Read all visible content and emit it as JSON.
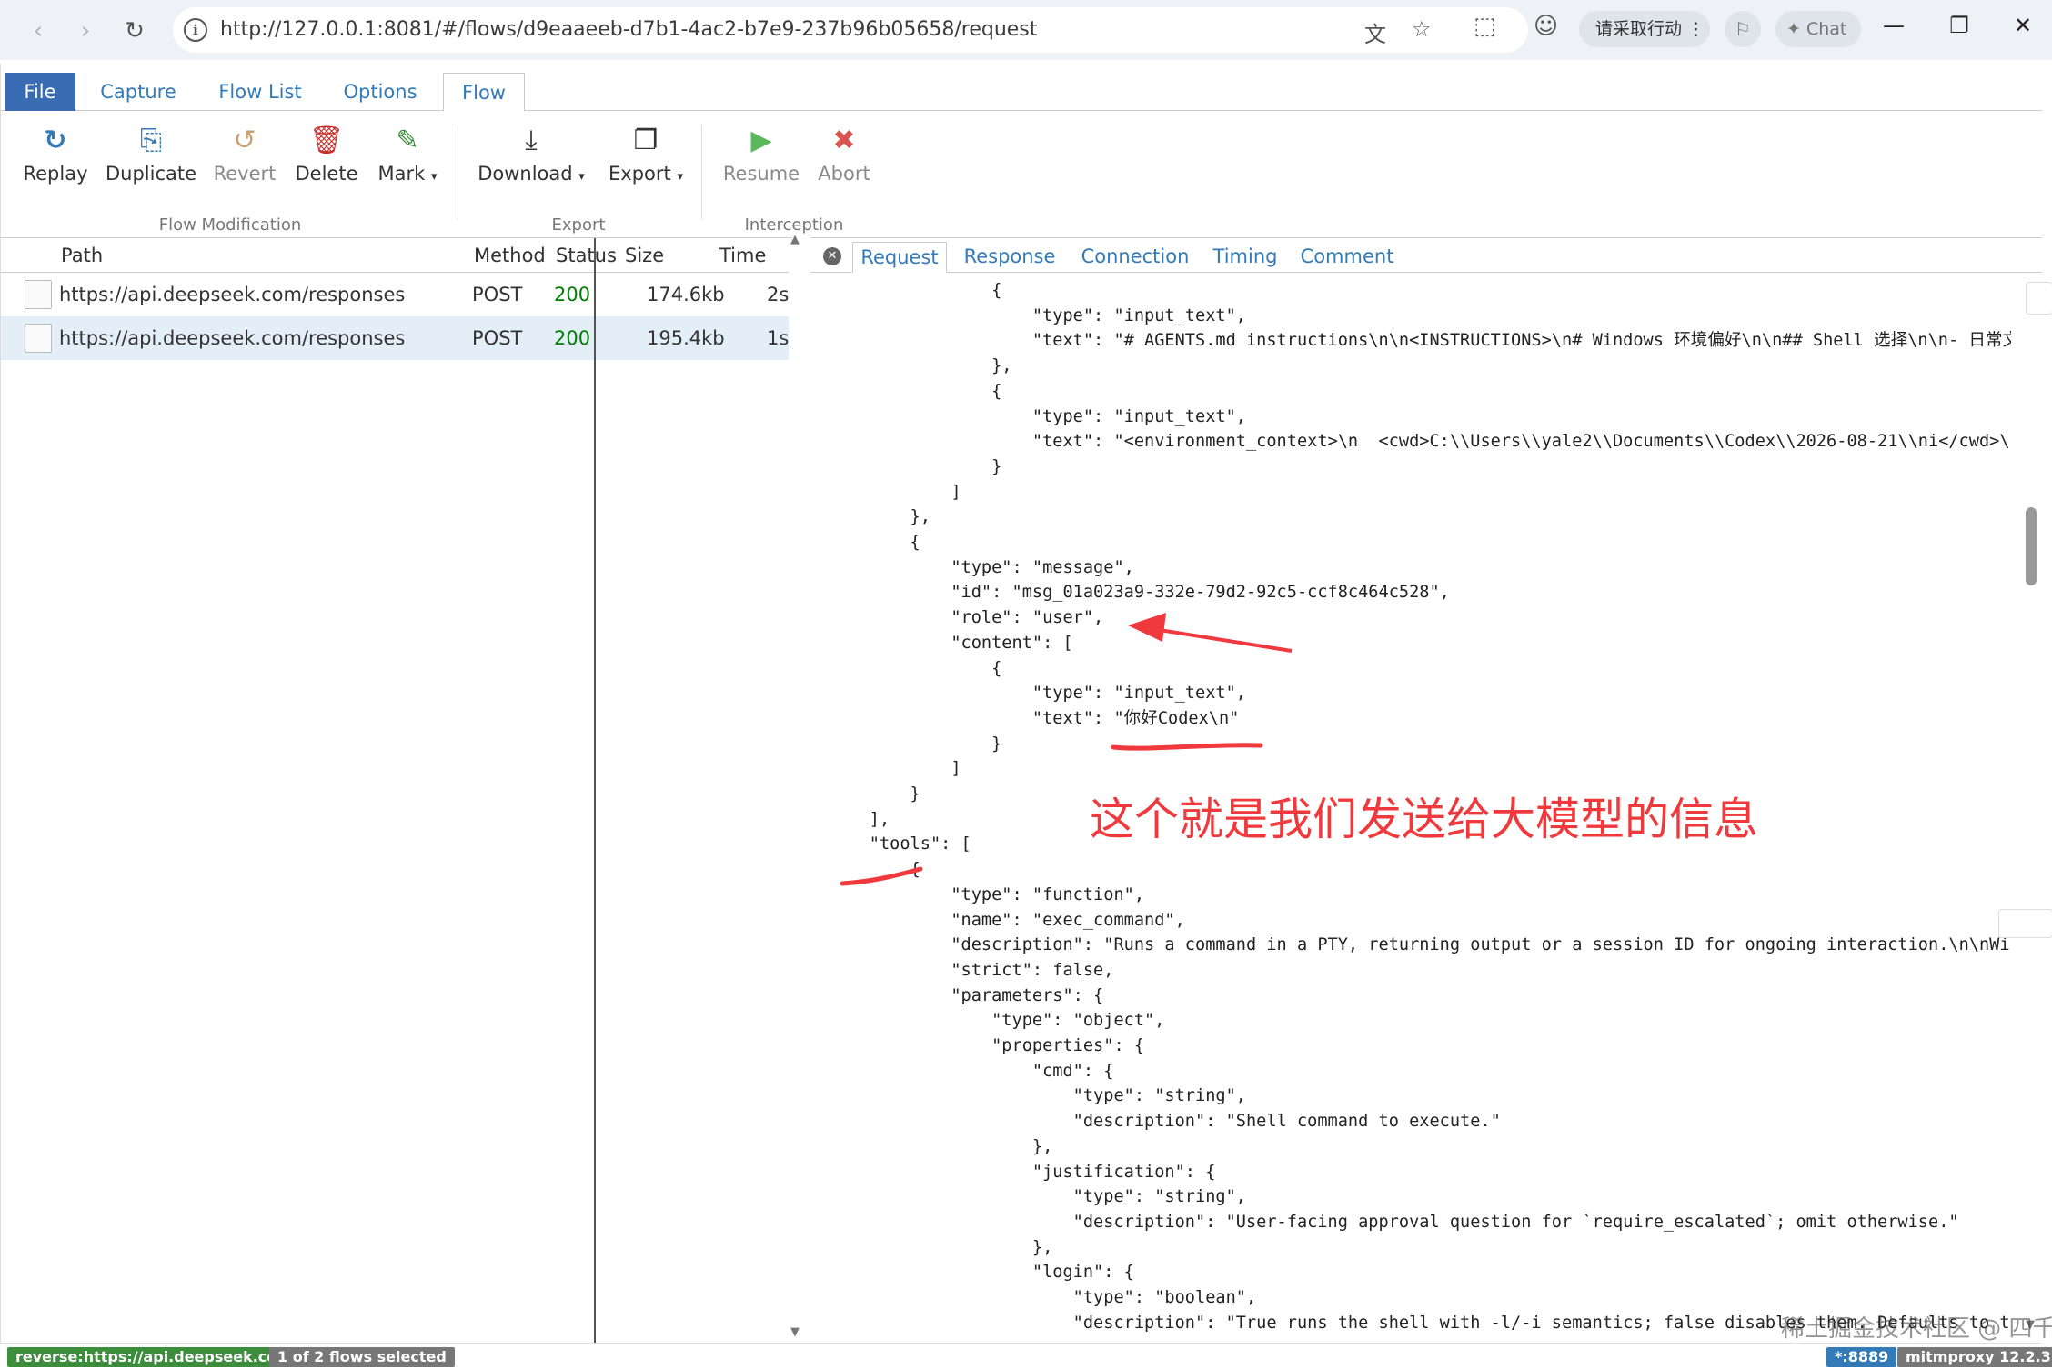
{
  "browser": {
    "url": "http://127.0.0.1:8081/#/flows/d9eaaeeb-d7b1-4ac2-b7e9-237b96b05658/request",
    "translate_pill": "请采取行动",
    "chat_label": "Chat"
  },
  "menu": {
    "tabs": [
      "File",
      "Capture",
      "Flow List",
      "Options",
      "Flow"
    ],
    "active": "Flow"
  },
  "toolbar": {
    "replay": "Replay",
    "duplicate": "Duplicate",
    "revert": "Revert",
    "delete": "Delete",
    "mark": "Mark",
    "download": "Download",
    "export": "Export",
    "resume": "Resume",
    "abort": "Abort",
    "groups": {
      "flow_modification": "Flow Modification",
      "export": "Export",
      "interception": "Interception"
    }
  },
  "flow_table": {
    "columns": {
      "path": "Path",
      "method": "Method",
      "status": "Status",
      "size": "Size",
      "time": "Time"
    },
    "rows": [
      {
        "path": "https://api.deepseek.com/responses",
        "method": "POST",
        "status": "200",
        "size": "174.6kb",
        "time": "2s",
        "selected": false
      },
      {
        "path": "https://api.deepseek.com/responses",
        "method": "POST",
        "status": "200",
        "size": "195.4kb",
        "time": "1s",
        "selected": true
      }
    ]
  },
  "detail": {
    "tabs": [
      "Request",
      "Response",
      "Connection",
      "Timing",
      "Comment"
    ],
    "active_tab": "Request",
    "code_lines": [
      "                {",
      "                    \"type\": \"input_text\",",
      "                    \"text\": \"# AGENTS.md instructions\\n\\n<INSTRUCTIONS>\\n# Windows 环境偏好\\n\\n## Shell 选择\\n\\n- 日常文件",
      "                },",
      "                {",
      "                    \"type\": \"input_text\",",
      "                    \"text\": \"<environment_context>\\n  <cwd>C:\\\\Users\\\\yale2\\\\Documents\\\\Codex\\\\2026-08-21\\\\ni</cwd>\\n  <",
      "                }",
      "            ]",
      "        },",
      "        {",
      "            \"type\": \"message\",",
      "            \"id\": \"msg_01a023a9-332e-79d2-92c5-ccf8c464c528\",",
      "            \"role\": \"user\",",
      "            \"content\": [",
      "                {",
      "                    \"type\": \"input_text\",",
      "                    \"text\": \"你好Codex\\n\"",
      "                }",
      "            ]",
      "        }",
      "    ],",
      "    \"tools\": [",
      "        {",
      "            \"type\": \"function\",",
      "            \"name\": \"exec_command\",",
      "            \"description\": \"Runs a command in a PTY, returning output or a session ID for ongoing interaction.\\n\\nWindow",
      "            \"strict\": false,",
      "            \"parameters\": {",
      "                \"type\": \"object\",",
      "                \"properties\": {",
      "                    \"cmd\": {",
      "                        \"type\": \"string\",",
      "                        \"description\": \"Shell command to execute.\"",
      "                    },",
      "                    \"justification\": {",
      "                        \"type\": \"string\",",
      "                        \"description\": \"User-facing approval question for `require_escalated`; omit otherwise.\"",
      "                    },",
      "                    \"login\": {",
      "                        \"type\": \"boolean\",",
      "                        \"description\": \"True runs the shell with -l/-i semantics; false disables them. Defaults to true.\""
    ]
  },
  "annotation": {
    "text": "这个就是我们发送给大模型的信息",
    "color": "#f0393c"
  },
  "statusbar": {
    "mode": "reverse:https://api.deepseek.com",
    "selection": "1 of 2 flows selected",
    "port": "*:8889",
    "version": "mitmproxy 12.2.3"
  },
  "watermark": "稀土掘金技术社区 @ 四千岁",
  "colors": {
    "brand_blue": "#396cb2",
    "link_blue": "#337ab7",
    "status_green": "#008000",
    "replay_blue": "#337ab7",
    "delete_red": "#c9302c",
    "mark_green": "#3c8d3c",
    "resume_green": "#5cb85c",
    "abort_red": "#d9534f"
  }
}
